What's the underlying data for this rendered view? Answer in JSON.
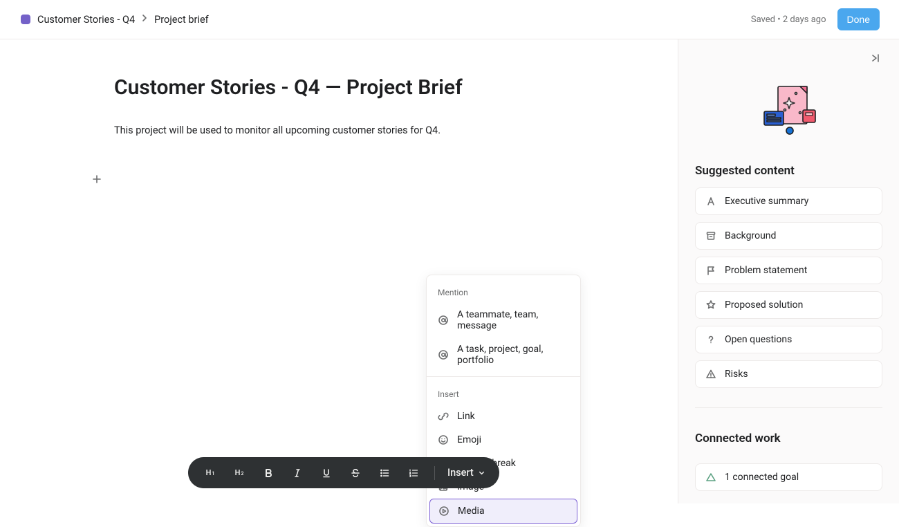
{
  "header": {
    "project_icon_color": "#7461c8",
    "breadcrumb": [
      "Customer Stories - Q4",
      "Project brief"
    ],
    "saved_status": "Saved • 2 days ago",
    "done_label": "Done"
  },
  "document": {
    "title": "Customer Stories - Q4 — Project Brief",
    "body": "This project will be used to monitor all upcoming customer stories for Q4."
  },
  "insert_menu": {
    "sections": {
      "mention": {
        "label": "Mention",
        "items": [
          {
            "icon": "at-icon",
            "label": "A teammate, team, message"
          },
          {
            "icon": "at-icon",
            "label": "A task, project, goal, portfolio"
          }
        ]
      },
      "insert": {
        "label": "Insert",
        "items": [
          {
            "icon": "link-icon",
            "label": "Link"
          },
          {
            "icon": "emoji-icon",
            "label": "Emoji"
          },
          {
            "icon": "section-break-icon",
            "label": "Section break"
          },
          {
            "icon": "image-icon",
            "label": "Image"
          },
          {
            "icon": "media-icon",
            "label": "Media",
            "highlighted": true
          }
        ]
      }
    }
  },
  "toolbar": {
    "h1": "H1",
    "h2": "H2",
    "insert_label": "Insert"
  },
  "sidebar": {
    "suggested_heading": "Suggested content",
    "suggestions": [
      {
        "icon": "text-a-icon",
        "label": "Executive summary"
      },
      {
        "icon": "archive-icon",
        "label": "Background"
      },
      {
        "icon": "flag-icon",
        "label": "Problem statement"
      },
      {
        "icon": "star-icon",
        "label": "Proposed solution"
      },
      {
        "icon": "question-icon",
        "label": "Open questions"
      },
      {
        "icon": "warning-icon",
        "label": "Risks"
      }
    ],
    "connected_heading": "Connected work",
    "connected_goal_label": "1 connected goal"
  }
}
